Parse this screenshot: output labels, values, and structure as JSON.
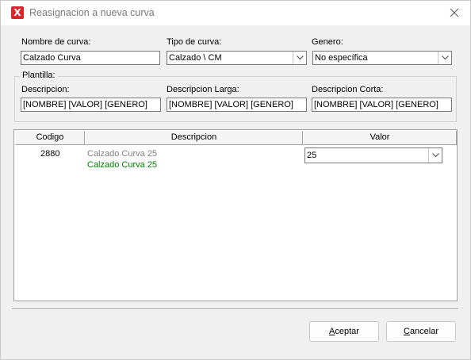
{
  "window": {
    "title": "Reasignacion a nueva curva",
    "icon": "app-x-icon"
  },
  "fields": {
    "nombre_label": "Nombre de curva:",
    "nombre_value": "Calzado Curva",
    "tipo_label": "Tipo de curva:",
    "tipo_value": "Calzado \\ CM",
    "genero_label": "Genero:",
    "genero_value": "No específica"
  },
  "plantilla": {
    "legend": "Plantilla:",
    "descripcion_label": "Descripcion:",
    "descripcion_value": "[NOMBRE] [VALOR] [GENERO]",
    "larga_label": "Descripcion Larga:",
    "larga_value": "[NOMBRE] [VALOR] [GENERO]",
    "corta_label": "Descripcion Corta:",
    "corta_value": "[NOMBRE] [VALOR] [GENERO]"
  },
  "grid": {
    "columns": [
      "Codigo",
      "Descripcion",
      "Valor"
    ],
    "rows": [
      {
        "codigo": "2880",
        "descripcion": "Calzado Curva 25",
        "descripcion_nueva": "Calzado Curva  25",
        "valor": "25"
      }
    ],
    "colors": {
      "old_desc": "#808080",
      "new_desc": "#008000"
    }
  },
  "buttons": {
    "aceptar_mnemonic": "A",
    "aceptar_rest": "ceptar",
    "cancelar_mnemonic": "C",
    "cancelar_rest": "ancelar"
  }
}
